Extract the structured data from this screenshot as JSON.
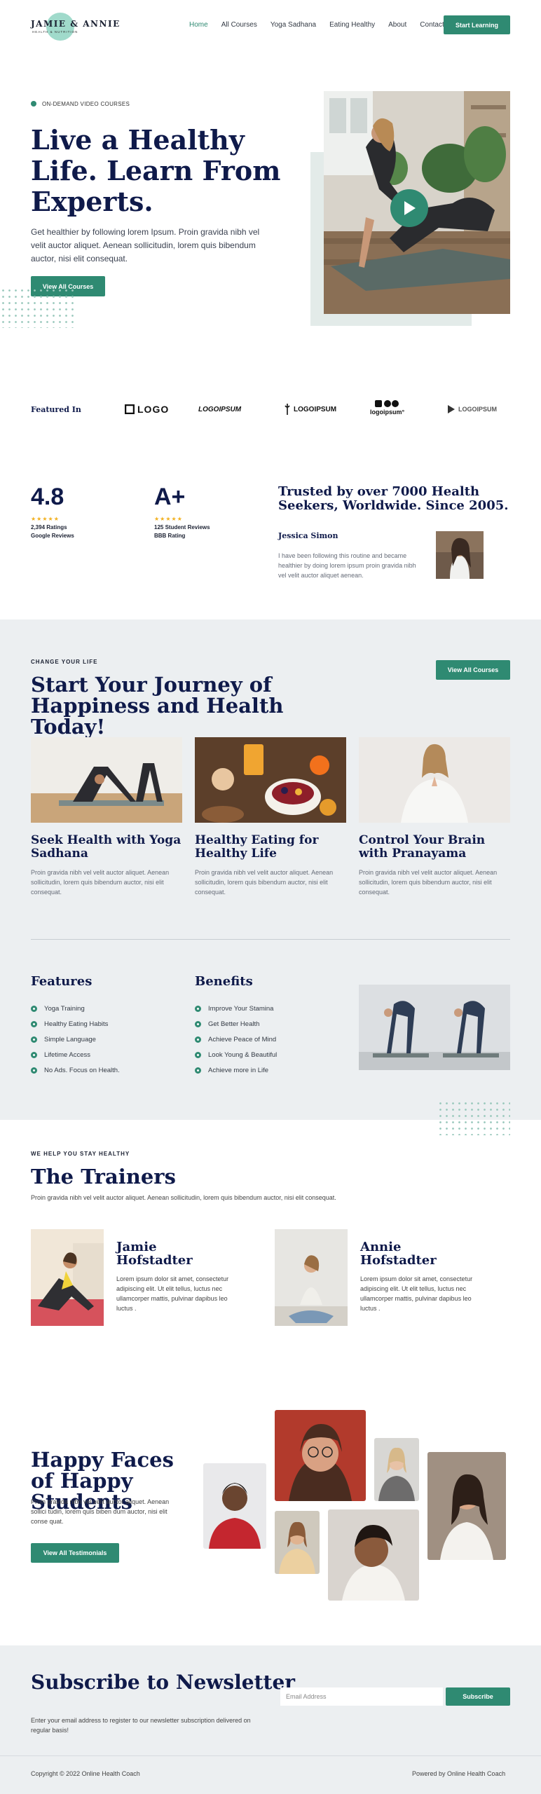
{
  "header": {
    "logo_text": "JAMIE & ANNIE",
    "logo_sub": "HEALTH & NUTRITION",
    "nav": [
      {
        "label": "Home",
        "active": true
      },
      {
        "label": "All Courses",
        "active": false
      },
      {
        "label": "Yoga Sadhana",
        "active": false
      },
      {
        "label": "Eating Healthy",
        "active": false
      },
      {
        "label": "About",
        "active": false
      },
      {
        "label": "Contact",
        "active": false
      }
    ],
    "cta": "Start Learning"
  },
  "hero": {
    "eyebrow": "ON-DEMAND VIDEO COURSES",
    "title": "Live a Healthy Life. Learn From Experts.",
    "description": "Get healthier by following lorem Ipsum. Proin gravida nibh vel velit auctor aliquet. Aenean sollicitudin, lorem quis bibendum auctor, nisi elit consequat.",
    "button": "View All Courses"
  },
  "featured": {
    "label": "Featured In",
    "logos": [
      "LOGO",
      "LOGOIPSUM",
      "LOGOIPSUM",
      "logoipsum°",
      "LOGOIPSUM"
    ]
  },
  "stats": {
    "rating_value": "4.8",
    "rating_stars": "★★★★★",
    "rating_count": "2,394 Ratings",
    "rating_source": "Google Reviews",
    "grade_value": "A+",
    "grade_stars": "★★★★★",
    "grade_count": "125 Student Reviews",
    "grade_source": "BBB Rating",
    "trust_title": "Trusted by over 7000 Health Seekers, Worldwide. Since 2005.",
    "testimonial_name": "Jessica Simon",
    "testimonial_text": "I have been following this routine and became healthier by doing lorem ipsum proin gravida nibh vel velit auctor aliquet aenean."
  },
  "journey": {
    "eyebrow": "CHANGE YOUR LIFE",
    "title": "Start Your Journey of Happiness and Health Today!",
    "button": "View All Courses",
    "cards": [
      {
        "title": "Seek Health with Yoga Sadhana",
        "desc": "Proin gravida nibh vel velit auctor aliquet. Aenean sollicitudin, lorem quis bibendum auctor, nisi elit consequat."
      },
      {
        "title": "Healthy Eating for Healthy Life",
        "desc": "Proin gravida nibh vel velit auctor aliquet. Aenean sollicitudin, lorem quis bibendum auctor, nisi elit consequat."
      },
      {
        "title": "Control Your Brain with Pranayama",
        "desc": "Proin gravida nibh vel velit auctor aliquet. Aenean sollicitudin, lorem quis bibendum auctor, nisi elit consequat."
      }
    ],
    "features_title": "Features",
    "features": [
      "Yoga Training",
      "Healthy Eating Habits",
      "Simple Language",
      "Lifetime Access",
      "No Ads. Focus on Health."
    ],
    "benefits_title": "Benefits",
    "benefits": [
      "Improve Your Stamina",
      "Get Better Health",
      "Achieve Peace of Mind",
      "Look Young & Beautiful",
      "Achieve more in Life"
    ]
  },
  "trainers": {
    "eyebrow": "WE HELP YOU STAY HEALTHY",
    "title": "The Trainers",
    "description": "Proin gravida nibh vel velit auctor aliquet. Aenean sollicitudin, lorem quis bibendum auctor, nisi elit consequat.",
    "list": [
      {
        "name": "Jamie Hofstadter",
        "desc": "Lorem ipsum dolor sit amet, consectetur adipiscing elit. Ut elit tellus, luctus nec ullamcorper mattis, pulvinar dapibus leo luctus ."
      },
      {
        "name": "Annie Hofstadter",
        "desc": "Lorem ipsum dolor sit amet, consectetur adipiscing elit. Ut elit tellus, luctus nec ullamcorper mattis, pulvinar dapibus leo luctus ."
      }
    ]
  },
  "faces": {
    "title": "Happy Faces of Happy Students",
    "description": "Proin gravida nibh vel velit auctor aliquet. Aenean sollici tudin, lorem quis biben dum auctor, nisi elit conse quat.",
    "button": "View All Testimonials"
  },
  "newsletter": {
    "title": "Subscribe to Newsletter",
    "description": "Enter your email address to register to our newsletter subscription delivered on regular basis!",
    "placeholder": "Email Address",
    "button": "Subscribe"
  },
  "footer": {
    "copyright": "Copyright © 2022 Online Health Coach",
    "powered": "Powered by Online Health Coach"
  },
  "colors": {
    "accent": "#2f8a72",
    "heading": "#0f1a4a",
    "section_bg": "#eceff1"
  }
}
